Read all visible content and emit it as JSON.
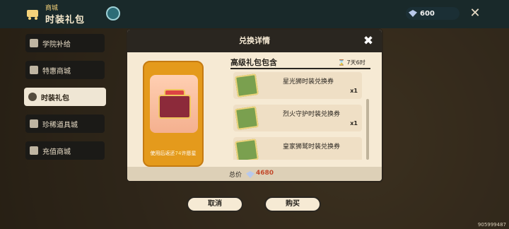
{
  "header": {
    "store_small": "商城",
    "store_main": "时装礼包"
  },
  "currency": {
    "amount": "600"
  },
  "sidebar": {
    "items": [
      {
        "label": "学院补给",
        "active": false
      },
      {
        "label": "特惠商城",
        "active": false
      },
      {
        "label": "时装礼包",
        "active": true
      },
      {
        "label": "珍稀道具城",
        "active": false
      },
      {
        "label": "充值商城",
        "active": false
      }
    ]
  },
  "modal": {
    "title": "兑换详情",
    "pack_title": "高级礼包包含",
    "timer": "7天6时",
    "pack_note_prefix": "使用后返还",
    "pack_note_highlight": "74",
    "pack_note_suffix": "许愿星",
    "items": [
      {
        "name": "星光狮时装兑换券",
        "qty": "x1"
      },
      {
        "name": "烈火守护时装兑换券",
        "qty": "x1"
      },
      {
        "name": "皇家狮鹫时装兑换券",
        "qty": ""
      }
    ],
    "total_label": "总价",
    "total_value": "4680"
  },
  "buttons": {
    "cancel": "取消",
    "buy": "购买"
  },
  "uid": "905999487",
  "colors": {
    "accent_orange": "#e49a1c",
    "price_red": "#c34a2c",
    "dark": "#2a2620",
    "paper": "#f6ead4"
  }
}
